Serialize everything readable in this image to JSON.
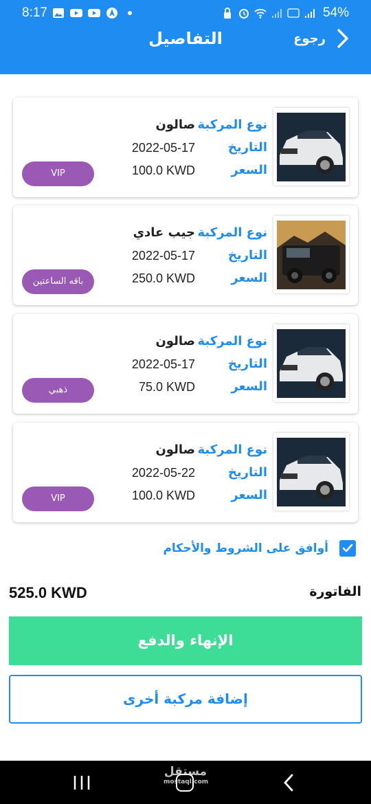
{
  "status_bar": {
    "time": "8:17",
    "battery": "54%"
  },
  "header": {
    "title": "التفاصيل",
    "back_label": "رجوع"
  },
  "labels": {
    "vehicle_type": "نوع المركبة",
    "date": "التاريخ",
    "price": "السعر"
  },
  "bookings": [
    {
      "vehicle_type": "صالون",
      "date": "2022-05-17",
      "price": "100.0 KWD",
      "package": "VIP",
      "image": "white-suv"
    },
    {
      "vehicle_type": "جيب عادي",
      "date": "2022-05-17",
      "price": "250.0 KWD",
      "package": "باقه الساعتين",
      "image": "black-jeep"
    },
    {
      "vehicle_type": "صالون",
      "date": "2022-05-17",
      "price": "75.0 KWD",
      "package": "ذهبي",
      "image": "white-suv"
    },
    {
      "vehicle_type": "صالون",
      "date": "2022-05-22",
      "price": "100.0 KWD",
      "package": "VIP",
      "image": "white-suv"
    }
  ],
  "terms": {
    "text": "أوافق على الشروط والأحكام",
    "checked": true
  },
  "invoice": {
    "label": "الفاتورة",
    "total": "525.0 KWD"
  },
  "buttons": {
    "finish": "الإنهاء والدفع",
    "add_vehicle": "إضافة مركبة أخرى"
  },
  "watermark": {
    "text": "مستقل",
    "sub": "mostaql.com"
  },
  "colors": {
    "primary": "#1e8cf0",
    "finish": "#3ddc97",
    "badge": "#9b59b6"
  }
}
